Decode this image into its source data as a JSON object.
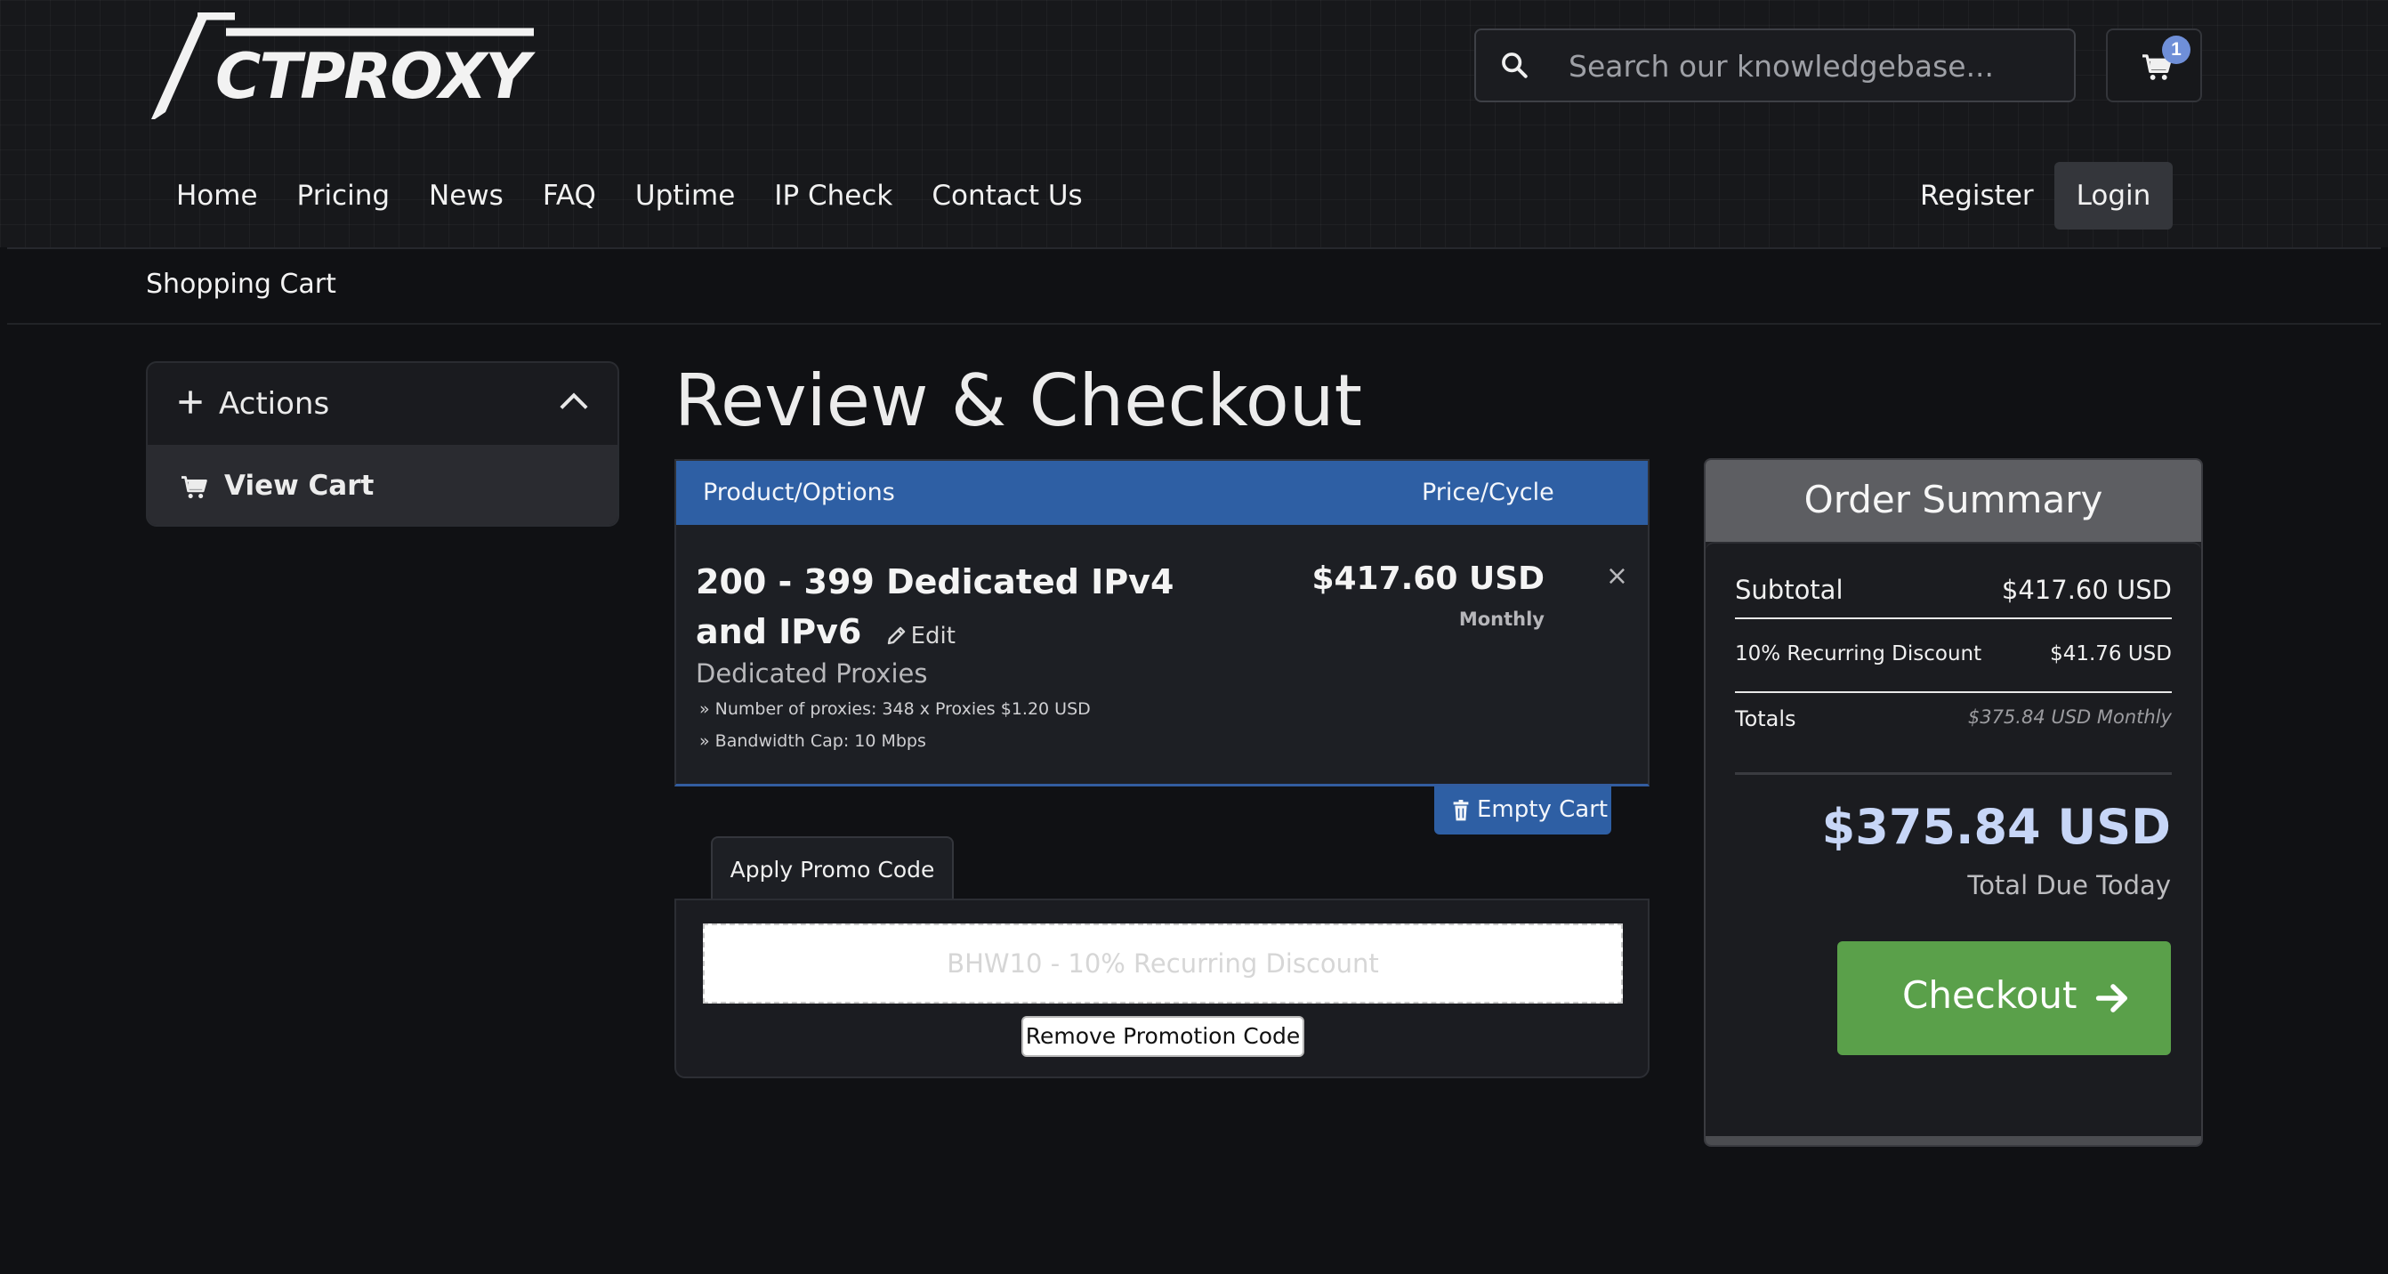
{
  "brand": {
    "logo_text": "ACTPROXY"
  },
  "search": {
    "placeholder": "Search our knowledgebase..."
  },
  "cart": {
    "badge_count": "1"
  },
  "nav": {
    "items": [
      "Home",
      "Pricing",
      "News",
      "FAQ",
      "Uptime",
      "IP Check",
      "Contact Us"
    ],
    "register": "Register",
    "login": "Login"
  },
  "breadcrumb": "Shopping Cart",
  "sidebar": {
    "actions_title": "Actions",
    "view_cart": "View Cart"
  },
  "page_title": "Review & Checkout",
  "table": {
    "col_product": "Product/Options",
    "col_price": "Price/Cycle",
    "item": {
      "name": "200 - 399 Dedicated IPv4 and IPv6",
      "edit": "Edit",
      "group": "Dedicated Proxies",
      "options": [
        "» Number of proxies: 348 x Proxies $1.20 USD",
        "» Bandwidth Cap: 10 Mbps"
      ],
      "price": "$417.60 USD",
      "cycle": "Monthly",
      "remove": "×"
    }
  },
  "empty_cart": "Empty Cart",
  "promo": {
    "tab": "Apply Promo Code",
    "code": "BHW10 - 10% Recurring Discount",
    "remove": "Remove Promotion Code"
  },
  "summary": {
    "title": "Order Summary",
    "subtotal_label": "Subtotal",
    "subtotal_value": "$417.60 USD",
    "discount_label": "10% Recurring Discount",
    "discount_value": "$41.76 USD",
    "totals_label": "Totals",
    "totals_value": "$375.84 USD Monthly",
    "total_due": "$375.84 USD",
    "total_due_label": "Total Due Today",
    "checkout": "Checkout"
  },
  "colors": {
    "accent_blue": "#2e5fa4",
    "checkout_green": "#5aa04a",
    "background": "#101114"
  }
}
